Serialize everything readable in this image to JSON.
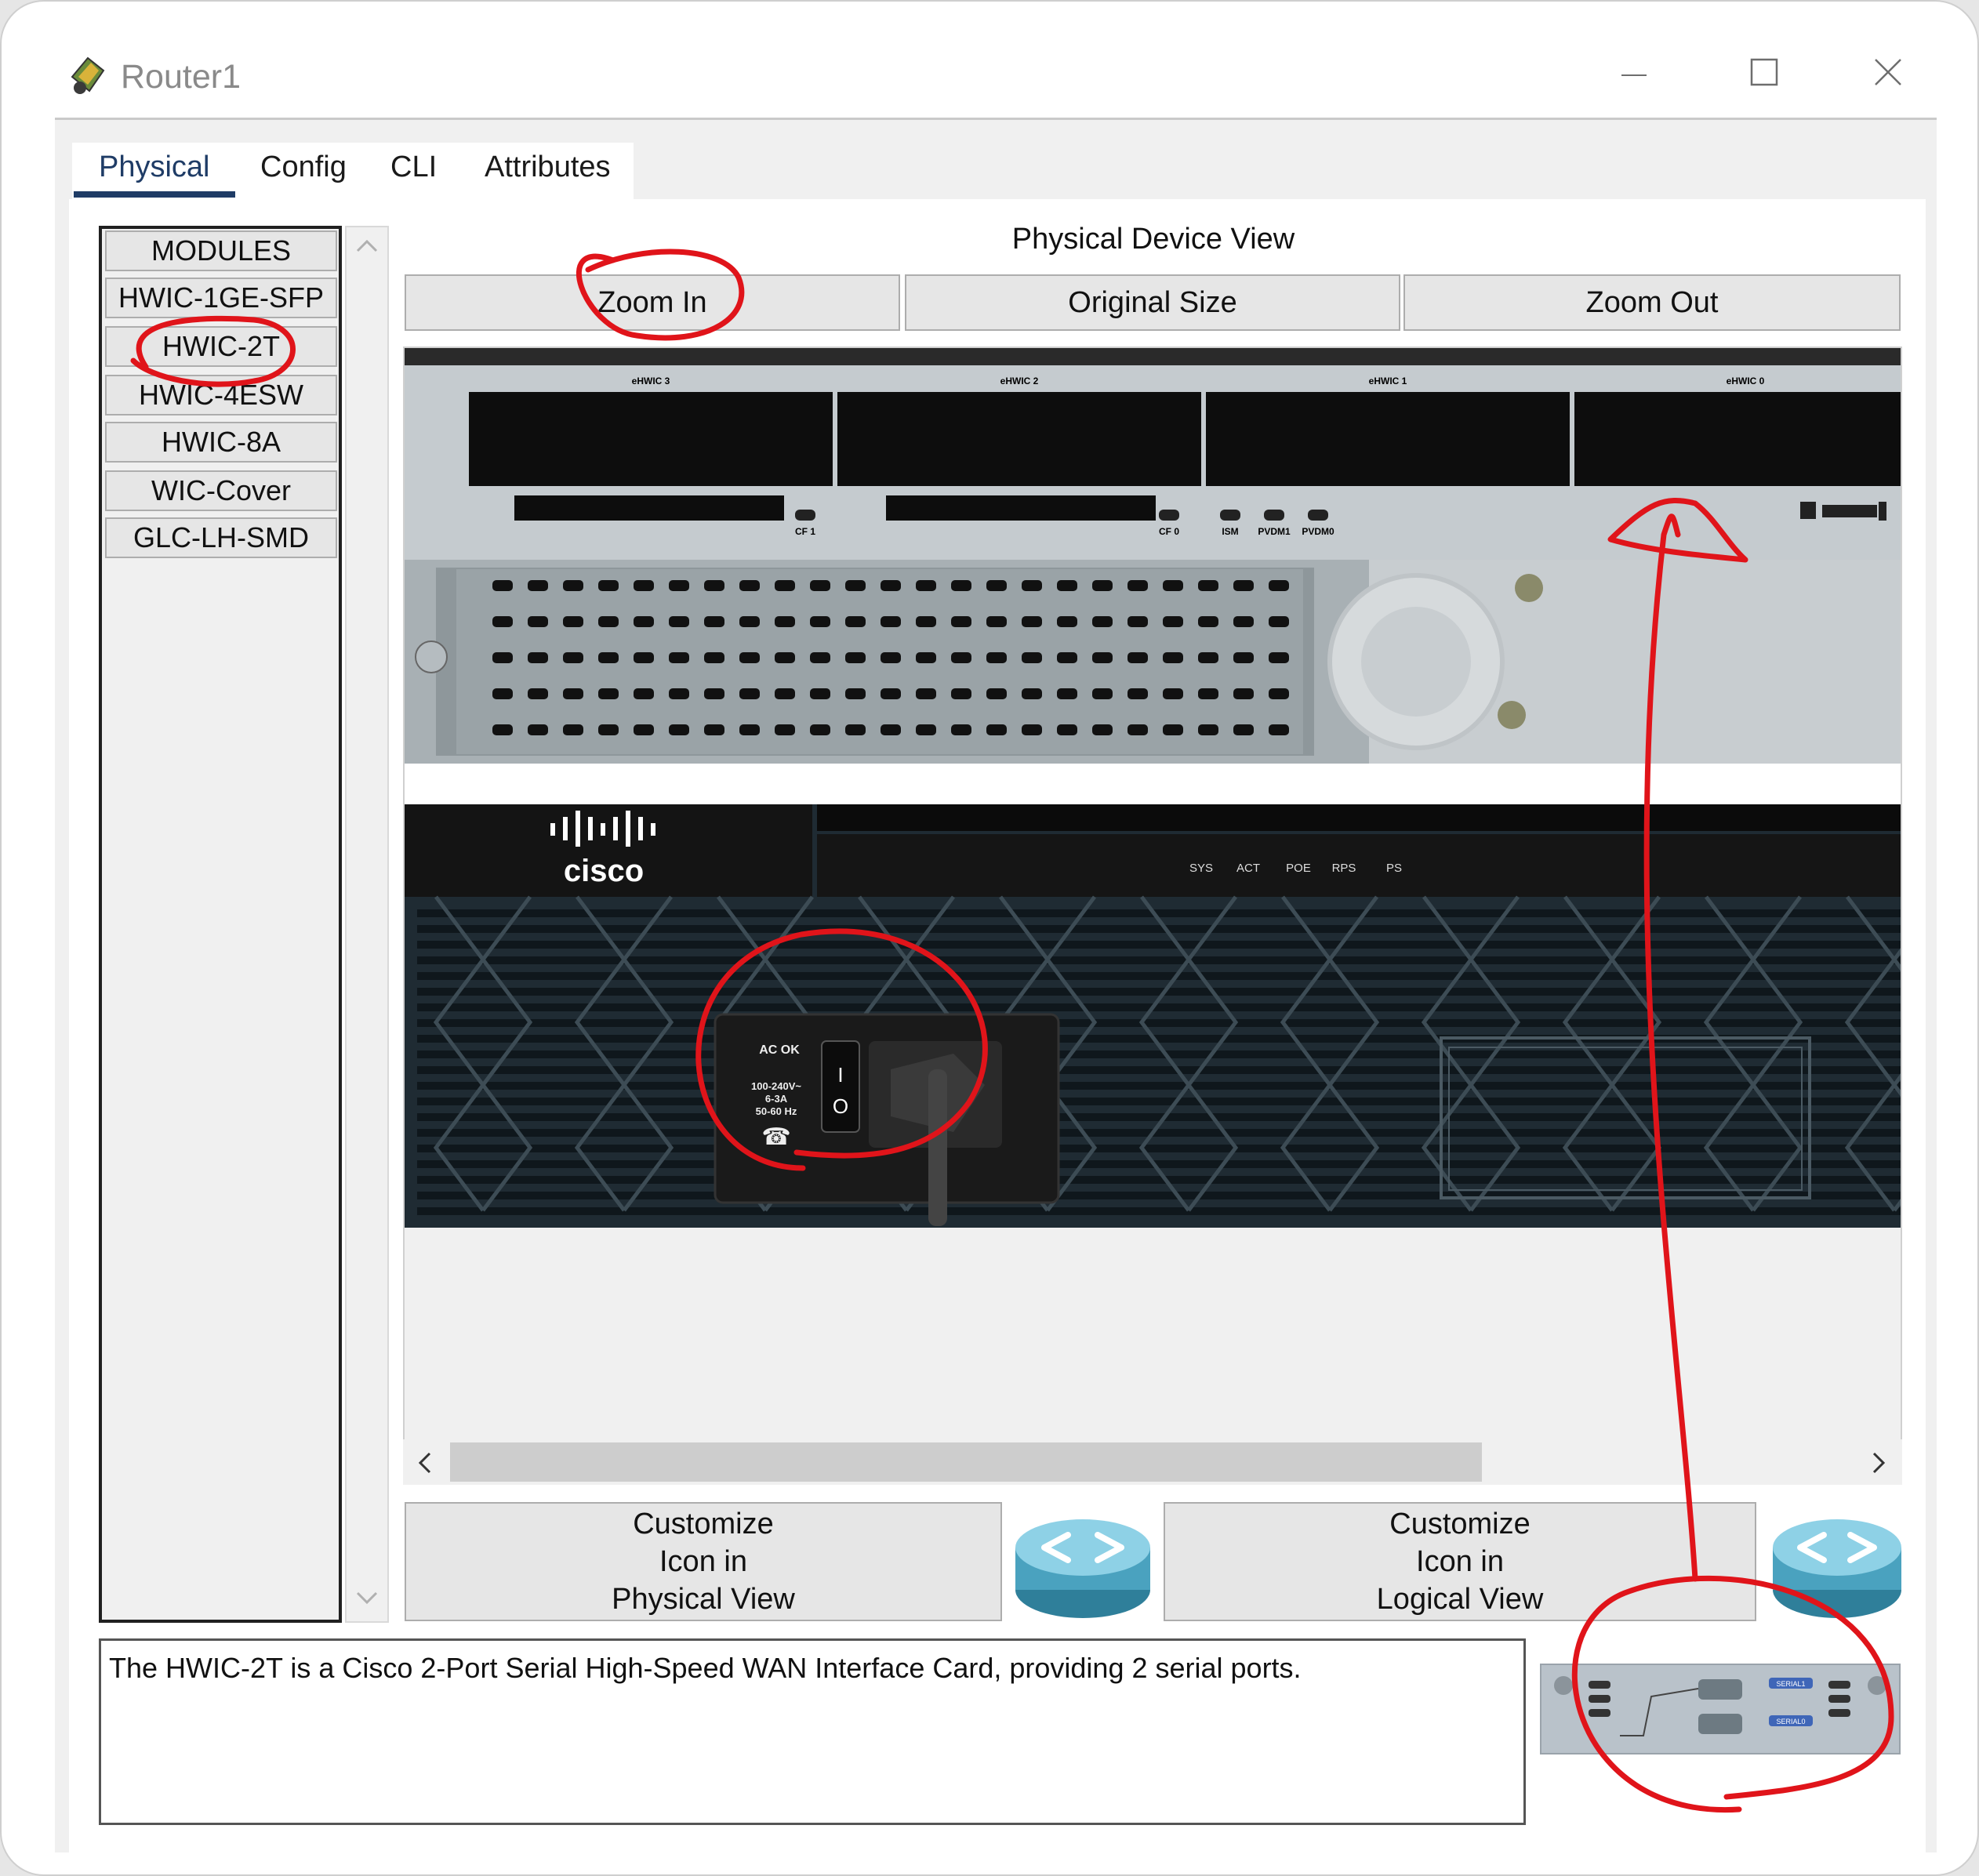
{
  "window": {
    "title": "Router1",
    "controls": {
      "minimize": "—",
      "maximize": "☐",
      "close": "✕"
    }
  },
  "tabs": [
    {
      "label": "Physical",
      "active": true
    },
    {
      "label": "Config",
      "active": false
    },
    {
      "label": "CLI",
      "active": false
    },
    {
      "label": "Attributes",
      "active": false
    }
  ],
  "modules": {
    "items": [
      "MODULES",
      "HWIC-1GE-SFP",
      "HWIC-2T",
      "HWIC-4ESW",
      "HWIC-8A",
      "WIC-Cover",
      "GLC-LH-SMD"
    ],
    "selected": "HWIC-2T"
  },
  "physical_view": {
    "title": "Physical Device View",
    "zoom_in": "Zoom In",
    "original_size": "Original Size",
    "zoom_out": "Zoom Out"
  },
  "device": {
    "slots": [
      "eHWIC 3",
      "eHWIC 2",
      "eHWIC 1",
      "eHWIC 0"
    ],
    "front_labels": [
      "CF 1",
      "CF 0",
      "ISM",
      "PVDM1",
      "PVDM0"
    ],
    "brand": "cisco",
    "leds": [
      "SYS",
      "ACT",
      "POE",
      "RPS",
      "PS"
    ],
    "power": {
      "status": "AC OK",
      "rating_line1": "100-240V~",
      "rating_line2": "6-3A",
      "rating_line3": "50-60 Hz",
      "switch_on": "I",
      "switch_off": "O"
    }
  },
  "customize": {
    "physical": "Customize\nIcon in\nPhysical View",
    "logical": "Customize\nIcon in\nLogical View"
  },
  "description": "The HWIC-2T is a Cisco 2-Port Serial High-Speed WAN Interface Card, providing 2 serial ports.",
  "module_preview": {
    "port_labels": [
      "SERIAL1",
      "SERIAL0"
    ]
  },
  "annotation_color": "#e0141a"
}
